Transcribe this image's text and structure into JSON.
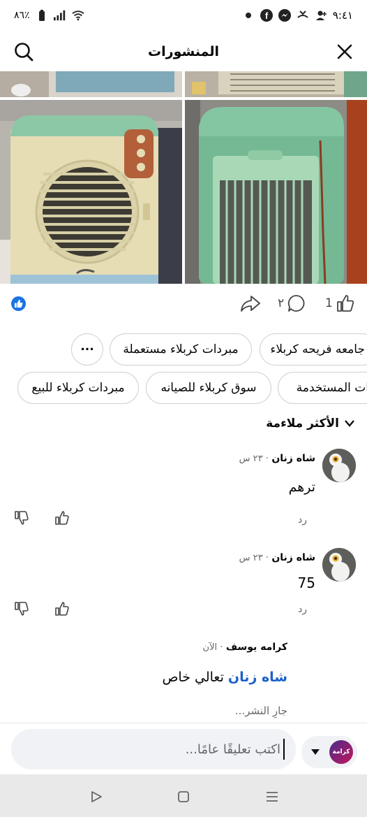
{
  "status_bar": {
    "time": "٩:٤١",
    "battery": "٨٦٪"
  },
  "header": {
    "title": "المنشورات",
    "close_icon": "close-icon",
    "search_icon": "search-icon"
  },
  "post": {
    "likes_count": "1",
    "comments_count": "٢",
    "colors": {
      "accent": "#1b74e4"
    }
  },
  "chips_row1": [
    {
      "label": "جامعه فريحه كربلاء"
    },
    {
      "label": "مبردات كربلاء مستعملة"
    },
    {
      "label": "..."
    }
  ],
  "chips_row2": [
    {
      "label": "ات المستخدمة"
    },
    {
      "label": "سوق كربلاء للصيانه"
    },
    {
      "label": "مبردات كربلاء للبيع"
    }
  ],
  "sort": {
    "label": "الأكثر ملاءمة"
  },
  "comments": [
    {
      "name": "شاه زنان",
      "time": "٢٣ س",
      "text": "ترهم",
      "reply": "رد"
    },
    {
      "name": "شاه زنان",
      "time": "٢٣ س",
      "text": "75",
      "reply": "رد"
    }
  ],
  "pending_comment": {
    "name": "كرامه يوسف",
    "time": "الآن",
    "mention": "شاه زنان",
    "text": "تعالي خاص",
    "status": "جارِ النشر..."
  },
  "composer": {
    "placeholder": "اكتب تعليقًا عامًا...",
    "avatar_text": "كرامة"
  }
}
